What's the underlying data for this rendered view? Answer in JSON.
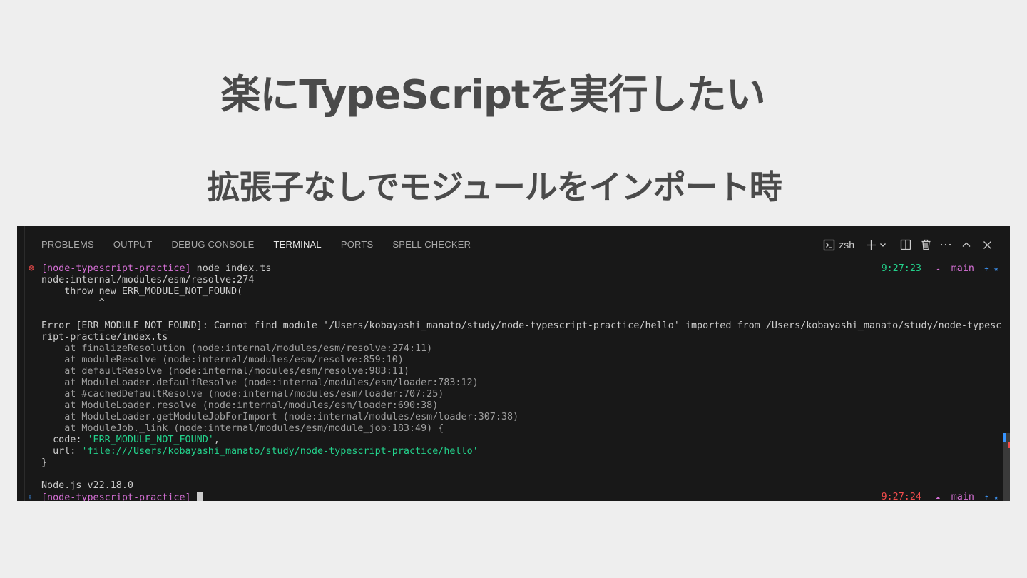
{
  "slide": {
    "title": "楽にTypeScriptを実行したい",
    "subtitle": "拡張子なしでモジュールをインポート時"
  },
  "panel": {
    "tabs": [
      "PROBLEMS",
      "OUTPUT",
      "DEBUG CONSOLE",
      "TERMINAL",
      "PORTS",
      "SPELL CHECKER"
    ],
    "active_tab": "TERMINAL",
    "shell": "zsh"
  },
  "terminal": {
    "prompt1": {
      "status_icon": "⊗",
      "dir": "[node-typescript-practice]",
      "command": "node index.ts",
      "time": "9:27:23",
      "branch_icon": "☁",
      "branch": "main",
      "markers": "☂ ★"
    },
    "lines": [
      "node:internal/modules/esm/resolve:274",
      "    throw new ERR_MODULE_NOT_FOUND(",
      "          ^",
      "",
      "Error [ERR_MODULE_NOT_FOUND]: Cannot find module '/Users/kobayashi_manato/study/node-typescript-practice/hello' imported from /Users/kobayashi_manato/study/node-typesc",
      "ript-practice/index.ts"
    ],
    "stack": [
      "    at finalizeResolution (node:internal/modules/esm/resolve:274:11)",
      "    at moduleResolve (node:internal/modules/esm/resolve:859:10)",
      "    at defaultResolve (node:internal/modules/esm/resolve:983:11)",
      "    at ModuleLoader.defaultResolve (node:internal/modules/esm/loader:783:12)",
      "    at #cachedDefaultResolve (node:internal/modules/esm/loader:707:25)",
      "    at ModuleLoader.resolve (node:internal/modules/esm/loader:690:38)",
      "    at ModuleLoader.getModuleJobForImport (node:internal/modules/esm/loader:307:38)",
      "    at ModuleJob._link (node:internal/modules/esm/module_job:183:49) {"
    ],
    "code_key": "  code: ",
    "code_val": "'ERR_MODULE_NOT_FOUND'",
    "code_tail": ",",
    "url_key": "  url: ",
    "url_val": "'file:///Users/kobayashi_manato/study/node-typescript-practice/hello'",
    "close_brace": "}",
    "node_version": "Node.js v22.18.0",
    "prompt2": {
      "status_icon": "✧",
      "dir": "[node-typescript-practice]",
      "time": "9:27:24",
      "branch_icon": "☁",
      "branch": "main",
      "markers": "☂ ★"
    }
  },
  "colors": {
    "error_red": "#f14c4c",
    "prompt_pink": "#d670d6",
    "green": "#23d18b",
    "accent_blue": "#3794ff"
  }
}
